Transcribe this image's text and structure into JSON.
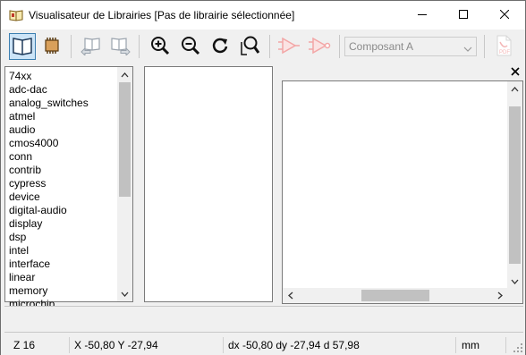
{
  "window": {
    "title": "Visualisateur de Librairies [Pas de librairie sélectionnée]",
    "app_icon": "library-viewer-icon",
    "controls": [
      "minimize-icon",
      "maximize-icon",
      "close-icon"
    ]
  },
  "toolbar": {
    "buttons": [
      {
        "name": "select-library-button",
        "icon": "open-book-icon",
        "active": true
      },
      {
        "name": "select-component-button",
        "icon": "chip-icon",
        "active": false
      },
      {
        "name": "previous-part-button",
        "icon": "book-left-arrow-icon",
        "active": false
      },
      {
        "name": "next-part-button",
        "icon": "book-right-arrow-icon",
        "active": false
      },
      {
        "name": "zoom-in-button",
        "icon": "zoom-in-icon",
        "active": false
      },
      {
        "name": "zoom-out-button",
        "icon": "zoom-out-icon",
        "active": false
      },
      {
        "name": "redraw-button",
        "icon": "redraw-icon",
        "active": false
      },
      {
        "name": "zoom-fit-button",
        "icon": "zoom-fit-icon",
        "active": false
      },
      {
        "name": "show-normal-body-button",
        "icon": "body-style-normal-icon",
        "active": false
      },
      {
        "name": "show-converted-body-button",
        "icon": "body-style-converted-icon",
        "active": false
      },
      {
        "name": "view-datasheet-button",
        "icon": "pdf-icon",
        "active": false
      }
    ],
    "unit_select": {
      "value": "Composant A"
    }
  },
  "libraries": [
    "74xx",
    "adc-dac",
    "analog_switches",
    "atmel",
    "audio",
    "cmos4000",
    "conn",
    "contrib",
    "cypress",
    "device",
    "digital-audio",
    "display",
    "dsp",
    "intel",
    "interface",
    "linear",
    "memory",
    "microchip"
  ],
  "panels": {
    "view_close_icon": "close-icon"
  },
  "status": {
    "zoom": "Z 16",
    "xy": "X -50,80  Y -27,94",
    "delta": "dx -50,80  dy -27,94  d 57,98",
    "units": "mm"
  }
}
